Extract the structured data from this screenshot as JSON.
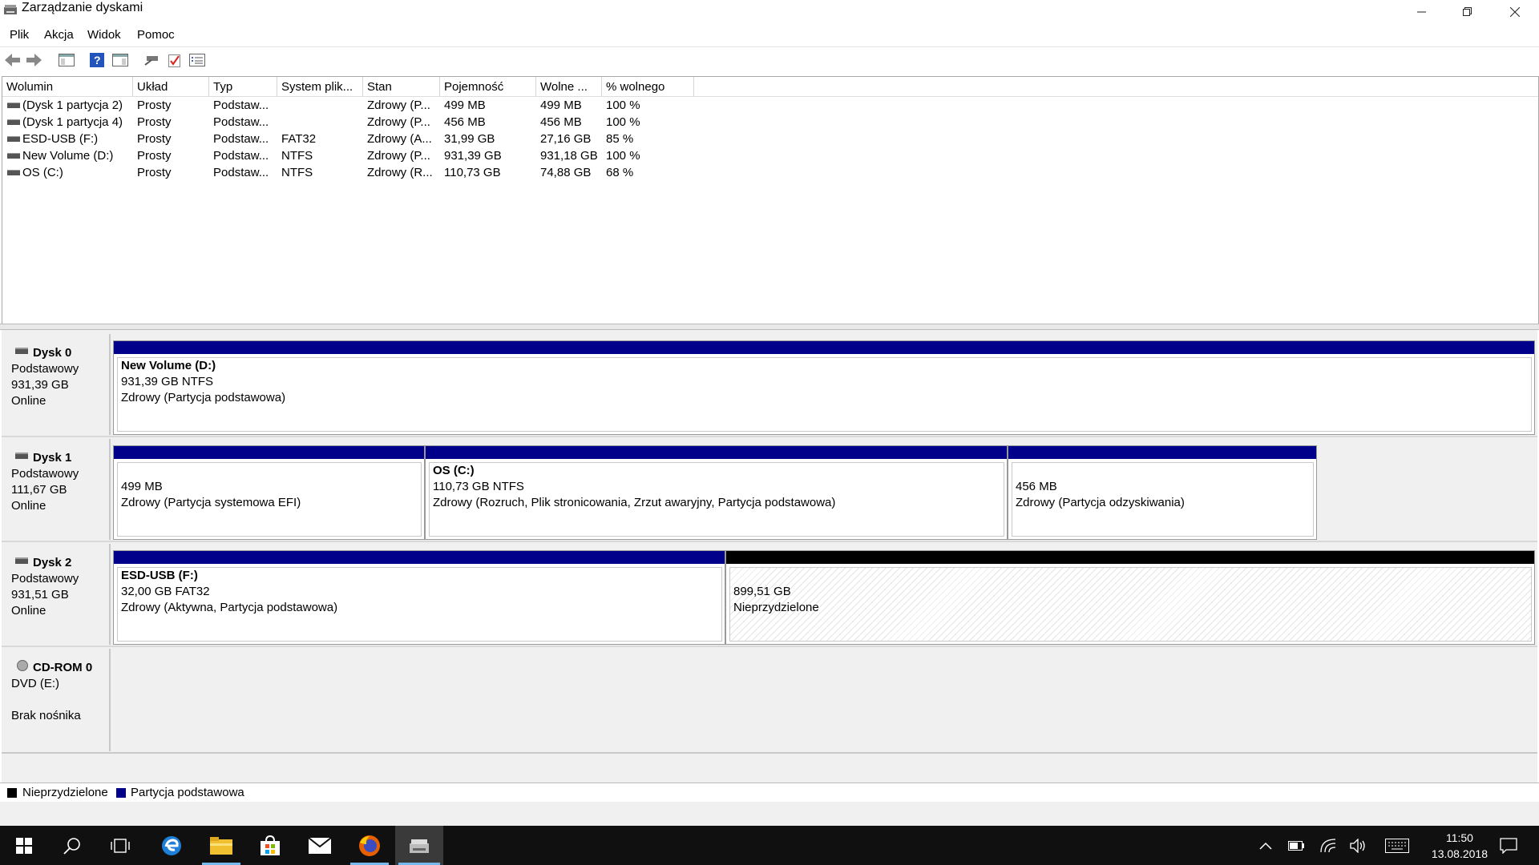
{
  "window": {
    "title": "Zarządzanie dyskami",
    "minimize_icon": "minimize-icon",
    "restore_icon": "restore-icon",
    "close_icon": "close-icon"
  },
  "menu": [
    "Plik",
    "Akcja",
    "Widok",
    "Pomoc"
  ],
  "toolbar": {
    "icons": [
      "back-arrow-icon",
      "forward-arrow-icon",
      "console-tree-icon",
      "help-icon",
      "properties-pane-icon",
      "connect-icon",
      "check-icon",
      "list-view-icon"
    ]
  },
  "volume_list": {
    "columns": [
      "Wolumin",
      "Układ",
      "Typ",
      "System plik...",
      "Stan",
      "Pojemność",
      "Wolne ...",
      "% wolnego"
    ],
    "rows": [
      [
        "(Dysk 1 partycja 2)",
        "Prosty",
        "Podstaw...",
        "",
        "Zdrowy (P...",
        "499 MB",
        "499 MB",
        "100 %"
      ],
      [
        "(Dysk 1 partycja 4)",
        "Prosty",
        "Podstaw...",
        "",
        "Zdrowy (P...",
        "456 MB",
        "456 MB",
        "100 %"
      ],
      [
        "ESD-USB (F:)",
        "Prosty",
        "Podstaw...",
        "FAT32",
        "Zdrowy (A...",
        "31,99 GB",
        "27,16 GB",
        "85 %"
      ],
      [
        "New Volume (D:)",
        "Prosty",
        "Podstaw...",
        "NTFS",
        "Zdrowy (P...",
        "931,39 GB",
        "931,18 GB",
        "100 %"
      ],
      [
        "OS (C:)",
        "Prosty",
        "Podstaw...",
        "NTFS",
        "Zdrowy (R...",
        "110,73 GB",
        "74,88 GB",
        "68 %"
      ]
    ]
  },
  "disks": [
    {
      "name": "Dysk 0",
      "type": "Podstawowy",
      "size": "931,39 GB",
      "status": "Online",
      "partitions": [
        {
          "title": "New Volume  (D:)",
          "size": "931,39 GB NTFS",
          "status": "Zdrowy (Partycja podstawowa)"
        }
      ]
    },
    {
      "name": "Dysk 1",
      "type": "Podstawowy",
      "size": "111,67 GB",
      "status": "Online",
      "partitions": [
        {
          "title": "",
          "size": "499 MB",
          "status": "Zdrowy (Partycja systemowa EFI)"
        },
        {
          "title": "OS  (C:)",
          "size": "110,73 GB NTFS",
          "status": "Zdrowy (Rozruch, Plik stronicowania, Zrzut awaryjny, Partycja podstawowa)"
        },
        {
          "title": "",
          "size": "456 MB",
          "status": "Zdrowy (Partycja odzyskiwania)"
        }
      ]
    },
    {
      "name": "Dysk 2",
      "type": "Podstawowy",
      "size": "931,51 GB",
      "status": "Online",
      "partitions": [
        {
          "title": "ESD-USB  (F:)",
          "size": "32,00 GB FAT32",
          "status": "Zdrowy (Aktywna, Partycja podstawowa)"
        },
        {
          "title": "",
          "size": "899,51 GB",
          "status": "Nieprzydzielone"
        }
      ]
    },
    {
      "name": "CD-ROM 0",
      "type": "DVD (E:)",
      "size": "",
      "status": "Brak nośnika",
      "partitions": []
    }
  ],
  "legend": [
    {
      "label": "Nieprzydzielone",
      "color": "#000000"
    },
    {
      "label": "Partycja podstawowa",
      "color": "#00008b"
    }
  ],
  "taskbar": {
    "apps": [
      "windows-start-icon",
      "search-icon",
      "task-view-icon",
      "edge-icon",
      "file-explorer-icon",
      "store-icon",
      "mail-icon",
      "firefox-icon",
      "disk-management-icon"
    ],
    "time": "11:50",
    "date": "13.08.2018"
  }
}
